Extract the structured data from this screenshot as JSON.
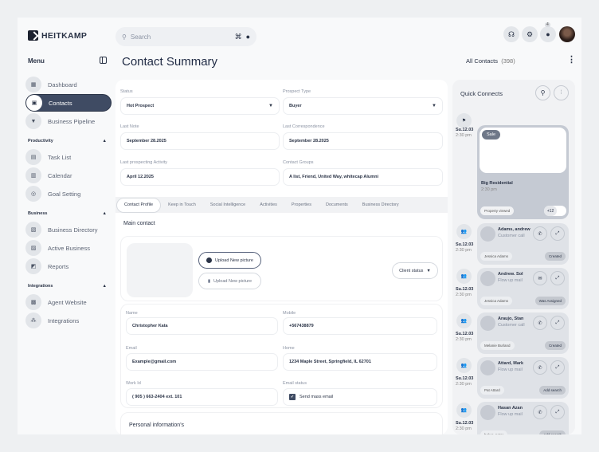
{
  "brand": {
    "name": "HEITKAMP"
  },
  "search": {
    "placeholder": "Search"
  },
  "topbar": {
    "notification_count": "4",
    "icons": [
      "headset-icon",
      "gear-icon",
      "bell-icon"
    ]
  },
  "sidebar": {
    "menu_label": "Menu",
    "groups": [
      {
        "title": "",
        "items": [
          {
            "label": "Dashboard",
            "icon": "▦"
          },
          {
            "label": "Contacts",
            "icon": "▣",
            "active": true
          },
          {
            "label": "Business Pipeline",
            "icon": "▼"
          }
        ]
      },
      {
        "title": "Productivity",
        "items": [
          {
            "label": "Task List",
            "icon": "▤"
          },
          {
            "label": "Calendar",
            "icon": "▥"
          },
          {
            "label": "Goal Setting",
            "icon": "◎"
          }
        ]
      },
      {
        "title": "Business",
        "items": [
          {
            "label": "Business Directory",
            "icon": "▧"
          },
          {
            "label": "Active Business",
            "icon": "▨"
          },
          {
            "label": "Reports",
            "icon": "◩"
          }
        ]
      },
      {
        "title": "Integrations",
        "items": [
          {
            "label": "Agent Website",
            "icon": "▩"
          },
          {
            "label": "Integrations",
            "icon": "⁂"
          }
        ]
      }
    ]
  },
  "header": {
    "title": "Contact Summary",
    "all_contacts_label": "All Contacts",
    "all_contacts_count": "(398)"
  },
  "summary": {
    "status_label": "Status",
    "status_value": "Hot Prospect",
    "prospect_label": "Prospect Type",
    "prospect_value": "Buyer",
    "last_note_label": "Last Note",
    "last_note_value": "September 28.2025",
    "last_corr_label": "Last Correspondence",
    "last_corr_value": "September 28.2025",
    "last_activity_label": "Last prospecting Activity",
    "last_activity_value": "April 12.2025",
    "groups_label": "Contact Groups",
    "groups_value": "A list, Friend, United Way, whitecap Alumni"
  },
  "tabs": [
    "Contact Profile",
    "Keep in Touch",
    "Social Intelligence",
    "Activities",
    "Properties",
    "Documents",
    "Business Directory"
  ],
  "main_contact": {
    "title": "Main contact",
    "upload_label": "Upload New picture",
    "delete_label": "Upload New picture",
    "client_status": "Client status",
    "name_label": "Name",
    "name_value": "Christopher Kata",
    "mobile_label": "Mobile",
    "mobile_value": "+567438879",
    "email_label": "Email",
    "email_value": "Example@gmail.com",
    "home_label": "Home",
    "home_value": "1234 Maple Street, Springfield, IL 62701",
    "work_label": "Work Id",
    "work_value": "( 905 ) 663-2404 ext. 101",
    "email_status_label": "Email status",
    "email_status_value": "Send mass email",
    "personal_title": "Personal information's"
  },
  "quick": {
    "title": "Quick Connects",
    "featured": {
      "date": "Su.12.03",
      "time": "2:30 pm",
      "badge": "Sale",
      "title": "Big Residential",
      "subtitle": "2:30 pm",
      "pill": "Property viewed",
      "count": "+12"
    },
    "items": [
      {
        "name": "Adams, andrew",
        "sub": "Customer call",
        "pill": "Jessica Adams",
        "tag": "Created",
        "date": "Su.12.03",
        "time": "2:30 pm",
        "action": "phone"
      },
      {
        "name": "Andrew. Sol",
        "sub": "Flow up mail",
        "pill": "Jessica Adams",
        "tag": "Was Assigned",
        "date": "Su.12.03",
        "time": "2:30 pm",
        "action": "mail"
      },
      {
        "name": "Araujo, Stan",
        "sub": "Customer call",
        "pill": "Melanie Burland",
        "tag": "Created",
        "date": "Su.12.03",
        "time": "2:30 pm",
        "action": "phone"
      },
      {
        "name": "Attard, Mark",
        "sub": "Flow up mail",
        "pill": "Pat Attard",
        "tag": "Add search",
        "date": "Su.12.03",
        "time": "2:30 pm",
        "action": "phone"
      },
      {
        "name": "Hasan Azan",
        "sub": "Flow up mail",
        "pill": "baker .peter",
        "tag": "Add search",
        "date": "Su.12.03",
        "time": "2:30 pm",
        "action": "phone"
      }
    ]
  }
}
